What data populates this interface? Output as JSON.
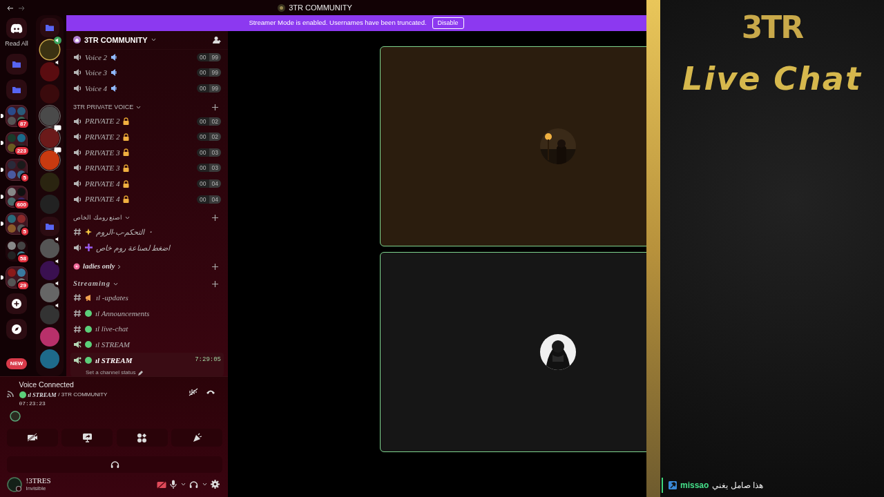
{
  "window": {
    "title": "3TR COMMUNITY"
  },
  "banner": {
    "text": "Streamer Mode is enabled. Usernames have been truncated.",
    "button": "Disable"
  },
  "server_rail": {
    "read_all": "Read All",
    "new_badge": "NEW",
    "items": [
      {
        "kind": "folder"
      },
      {
        "kind": "folder"
      },
      {
        "kind": "group",
        "badge": "87",
        "unread": true
      },
      {
        "kind": "group",
        "badge": "223",
        "unread": true
      },
      {
        "kind": "group",
        "badge": "5",
        "unread": true
      },
      {
        "kind": "group",
        "badge": "600",
        "unread": true
      },
      {
        "kind": "group",
        "badge": "5",
        "unread": true
      },
      {
        "kind": "group",
        "badge": "58",
        "unread": false
      },
      {
        "kind": "group",
        "badge": "29",
        "unread": true
      },
      {
        "kind": "add"
      },
      {
        "kind": "discover"
      }
    ]
  },
  "server_list": [
    {
      "kind": "folder",
      "selected": false,
      "unread": false
    },
    {
      "kind": "voice",
      "color": "#3b3212",
      "selected": true,
      "unread": false
    },
    {
      "kind": "voice",
      "color": "#5a0c10",
      "selected": false,
      "unread": false
    },
    {
      "kind": "server",
      "color": "#3a0a0c",
      "selected": false,
      "unread": false
    },
    {
      "kind": "server",
      "color": "#4a4a4a",
      "selected": false,
      "unread": true
    },
    {
      "kind": "chat",
      "color": "#6b1a1a",
      "selected": false,
      "unread": true
    },
    {
      "kind": "chat",
      "color": "#c83a10",
      "selected": false,
      "unread": true
    },
    {
      "kind": "server",
      "color": "#2a2410",
      "selected": false,
      "unread": false
    },
    {
      "kind": "server",
      "color": "#222222",
      "selected": false,
      "unread": false
    },
    {
      "kind": "folder",
      "selected": false,
      "unread": false
    },
    {
      "kind": "voice",
      "color": "#555555",
      "selected": false,
      "unread": false
    },
    {
      "kind": "voice",
      "color": "#3a1050",
      "selected": false,
      "unread": false
    },
    {
      "kind": "voice",
      "color": "#666666",
      "selected": false,
      "unread": false
    },
    {
      "kind": "voice",
      "color": "#333333",
      "selected": false,
      "unread": false
    },
    {
      "kind": "server",
      "color": "#b8306a",
      "selected": false,
      "unread": false
    },
    {
      "kind": "server",
      "color": "#1e6a8a",
      "selected": false,
      "unread": false
    }
  ],
  "channel_panel": {
    "server_name": "3TR COMMUNITY",
    "categories": [
      {
        "channels": [
          {
            "kind": "voice",
            "name": "Voice 2",
            "users": "00",
            "limit": "99",
            "selected": false
          },
          {
            "kind": "voice",
            "name": "Voice 3",
            "users": "00",
            "limit": "99",
            "selected": false
          },
          {
            "kind": "voice",
            "name": "Voice 4",
            "users": "00",
            "limit": "99",
            "selected": false
          }
        ]
      },
      {
        "kind": "plain",
        "name": "3TR PRIVATE VOICE",
        "collapsed": false,
        "channels": [
          {
            "kind": "private",
            "name": "PRIVATE 2",
            "users": "00",
            "limit": "02",
            "selected": false
          },
          {
            "kind": "private",
            "name": "PRIVATE 2",
            "users": "00",
            "limit": "02",
            "selected": false
          },
          {
            "kind": "private",
            "name": "PRIVATE 3",
            "users": "00",
            "limit": "03",
            "selected": false
          },
          {
            "kind": "private",
            "name": "PRIVATE 3",
            "users": "00",
            "limit": "03",
            "selected": false
          },
          {
            "kind": "private",
            "name": "PRIVATE 4",
            "users": "00",
            "limit": "04",
            "selected": false
          },
          {
            "kind": "private",
            "name": "PRIVATE 4",
            "users": "00",
            "limit": "04",
            "selected": false
          }
        ]
      },
      {
        "kind": "plain",
        "name": "اصنع رومك الخاص",
        "collapsed": false,
        "channels": [
          {
            "kind": "control",
            "name": "التحكم-ب-الروم ・",
            "selected": false
          },
          {
            "kind": "maker",
            "name": "اضغط لصناعة روم خاص",
            "selected": false
          }
        ]
      },
      {
        "kind": "flower",
        "name": "ladies only",
        "collapsed": true
      },
      {
        "kind": "fancy",
        "name": "Streaming",
        "collapsed": false,
        "channels": [
          {
            "kind": "updates",
            "name": "ıl -updates",
            "selected": false
          },
          {
            "kind": "text",
            "name": "ıl Announcements",
            "selected": false
          },
          {
            "kind": "text",
            "name": "ıl live-chat",
            "selected": false
          },
          {
            "kind": "stream",
            "name": "ıl STREAM",
            "selected": false
          },
          {
            "kind": "stream",
            "name": "ıl STREAM",
            "selected": true,
            "timer": "7:29:05",
            "status": "Set a channel status"
          }
        ]
      }
    ]
  },
  "voice_panel": {
    "status": "Voice Connected",
    "channel": "ıl STREAM",
    "server": "/ 3TR COMMUNITY",
    "elapsed": "07:23:23"
  },
  "user_panel": {
    "name": "!3TRES",
    "status": "Invisible"
  },
  "stage_tiles": [
    {
      "color": "#2b1d0e"
    },
    {
      "color": "#161616"
    }
  ],
  "overlay": {
    "logo": "3TR",
    "title": "Live Chat",
    "chat": [
      {
        "user": "missao",
        "message": "هذا صامل يغني"
      }
    ]
  }
}
